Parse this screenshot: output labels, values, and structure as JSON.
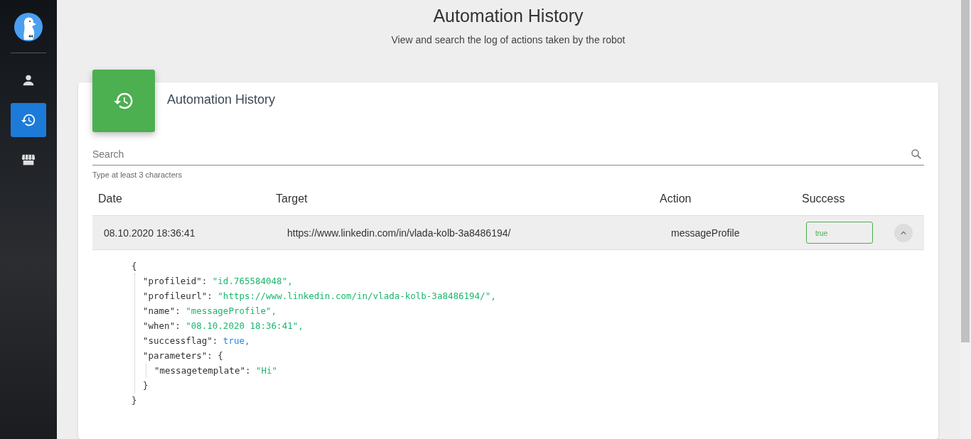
{
  "sidebar": {
    "items": [
      {
        "kind": "user",
        "selected": false
      },
      {
        "kind": "history",
        "selected": true
      },
      {
        "kind": "store",
        "selected": false
      }
    ]
  },
  "header": {
    "title": "Automation History",
    "subtitle": "View and search the log of actions taken by the robot"
  },
  "card": {
    "title": "Automation History",
    "search": {
      "placeholder": "Search",
      "hint": "Type at least 3 characters"
    },
    "table": {
      "columns": [
        "Date",
        "Target",
        "Action",
        "Success"
      ],
      "rows": [
        {
          "date": "08.10.2020 18:36:41",
          "target": "https://www.linkedin.com/in/vlada-kolb-3a8486194/",
          "action": "messageProfile",
          "success": "true",
          "expanded": true,
          "details": {
            "open": "{",
            "close": "}",
            "entries": [
              {
                "key": "\"profileid\":",
                "value": "\"id.765584048\",",
                "kind": "string"
              },
              {
                "key": "\"profileurl\":",
                "value": "\"https://www.linkedin.com/in/vlada-kolb-3a8486194/\",",
                "kind": "string"
              },
              {
                "key": "\"name\":",
                "value": "\"messageProfile\",",
                "kind": "string"
              },
              {
                "key": "\"when\":",
                "value": "\"08.10.2020 18:36:41\",",
                "kind": "string"
              },
              {
                "key": "\"successflag\":",
                "value": "true,",
                "kind": "boolean"
              },
              {
                "key": "\"parameters\":",
                "value": "{",
                "kind": "object",
                "close": "}",
                "children": [
                  {
                    "key": "\"messagetemplate\":",
                    "value": "\"Hi\"",
                    "kind": "string"
                  }
                ]
              }
            ]
          }
        }
      ]
    }
  }
}
